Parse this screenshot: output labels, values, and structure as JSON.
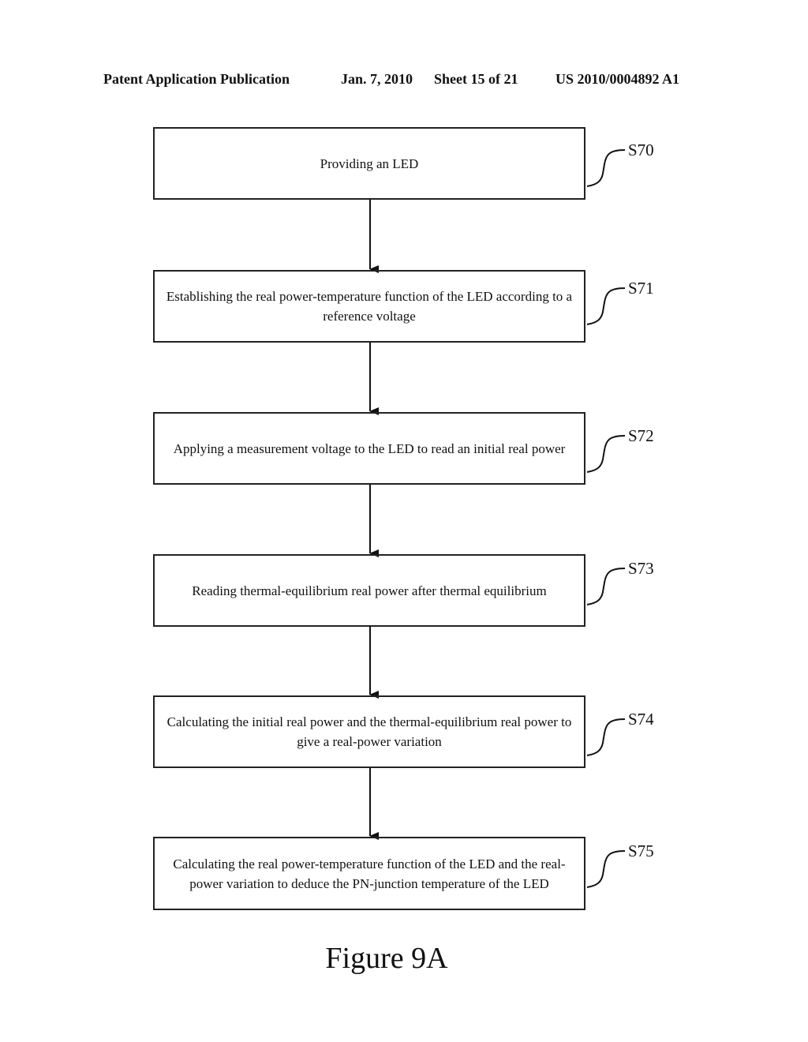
{
  "header": {
    "publication": "Patent Application Publication",
    "date": "Jan. 7, 2010",
    "sheet": "Sheet 15 of 21",
    "number": "US 2010/0004892 A1"
  },
  "steps": [
    {
      "label": "S70",
      "text": "Providing an LED"
    },
    {
      "label": "S71",
      "text": "Establishing the real power-temperature function of the LED according to a reference voltage"
    },
    {
      "label": "S72",
      "text": "Applying a measurement voltage to the LED to read an initial real power"
    },
    {
      "label": "S73",
      "text": "Reading thermal-equilibrium real power after thermal equilibrium"
    },
    {
      "label": "S74",
      "text": "Calculating the initial real power and the thermal-equilibrium real power to give a real-power variation"
    },
    {
      "label": "S75",
      "text": "Calculating the real power-temperature function of the LED and the real-power variation to deduce the PN-junction temperature of the LED"
    }
  ],
  "caption": "Figure 9A"
}
